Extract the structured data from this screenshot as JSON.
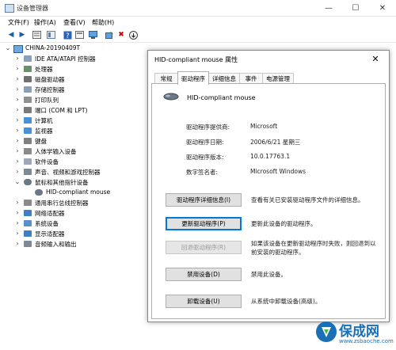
{
  "window": {
    "title": "设备管理器",
    "controls": {
      "minimize": "—",
      "maximize": "☐",
      "close": "✕"
    }
  },
  "menu": [
    "文件(F)",
    "操作(A)",
    "查看(V)",
    "帮助(H)"
  ],
  "tree": {
    "root": "CHINA-20190409T",
    "items": [
      {
        "label": "IDE ATA/ATAPI 控制器",
        "icon": "ide-controller-icon"
      },
      {
        "label": "处理器",
        "icon": "processor-icon"
      },
      {
        "label": "磁盘驱动器",
        "icon": "disk-drive-icon"
      },
      {
        "label": "存储控制器",
        "icon": "storage-controller-icon"
      },
      {
        "label": "打印队列",
        "icon": "print-queue-icon"
      },
      {
        "label": "端口 (COM 和 LPT)",
        "icon": "port-icon"
      },
      {
        "label": "计算机",
        "icon": "computer-icon"
      },
      {
        "label": "监视器",
        "icon": "monitor-icon"
      },
      {
        "label": "键盘",
        "icon": "keyboard-icon"
      },
      {
        "label": "人体学输入设备",
        "icon": "hid-icon"
      },
      {
        "label": "软件设备",
        "icon": "software-device-icon"
      },
      {
        "label": "声音、视频和游戏控制器",
        "icon": "sound-icon"
      },
      {
        "label": "鼠标和其他指针设备",
        "icon": "mouse-icon",
        "expanded": true
      },
      {
        "label": "HID-compliant mouse",
        "icon": "mouse-icon",
        "child": true
      },
      {
        "label": "通用串行总线控制器",
        "icon": "usb-icon"
      },
      {
        "label": "网络适配器",
        "icon": "network-adapter-icon"
      },
      {
        "label": "系统设备",
        "icon": "system-device-icon"
      },
      {
        "label": "显示适配器",
        "icon": "display-adapter-icon"
      },
      {
        "label": "音频输入和输出",
        "icon": "audio-io-icon"
      }
    ]
  },
  "dialog": {
    "title": "HID-compliant mouse 属性",
    "close": "✕",
    "tabs": [
      "常规",
      "驱动程序",
      "详细信息",
      "事件",
      "电源管理"
    ],
    "active_tab": "驱动程序",
    "device_name": "HID-compliant mouse",
    "properties": [
      {
        "label": "驱动程序提供商:",
        "value": "Microsoft"
      },
      {
        "label": "驱动程序日期:",
        "value": "2006/6/21 星期三"
      },
      {
        "label": "驱动程序版本:",
        "value": "10.0.17763.1"
      },
      {
        "label": "数字签名者:",
        "value": "Microsoft Windows"
      }
    ],
    "buttons": [
      {
        "label": "驱动程序详细信息(I)",
        "desc": "查看有关已安装驱动程序文件的详细信息。",
        "state": "normal"
      },
      {
        "label": "更新驱动程序(P)",
        "desc": "更新此设备的驱动程序。",
        "state": "focused"
      },
      {
        "label": "回退驱动程序(R)",
        "desc": "如果该设备在更新驱动程序时失败，则回退到以前安装的驱动程序。",
        "state": "disabled"
      },
      {
        "label": "禁用设备(D)",
        "desc": "禁用此设备。",
        "state": "normal"
      },
      {
        "label": "卸载设备(U)",
        "desc": "从系统中卸载设备(高级)。",
        "state": "normal"
      }
    ]
  },
  "watermark": {
    "text": "保成网",
    "url": "www.zsbaoche.com"
  }
}
